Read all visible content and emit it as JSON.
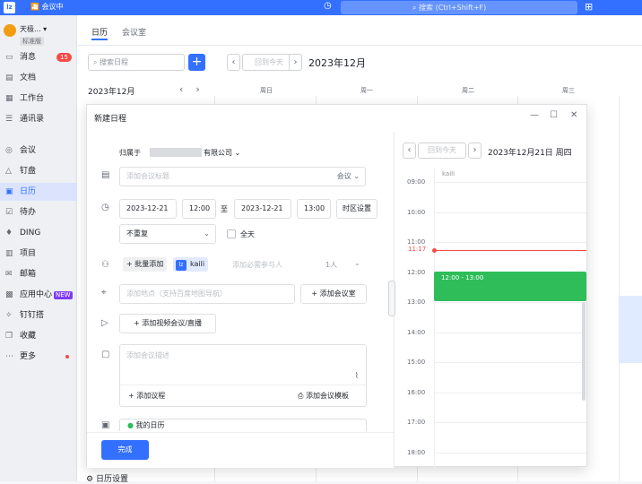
{
  "topbar": {
    "logo": "lz",
    "meeting_status": "会议中",
    "search_placeholder": "搜索 (Ctrl+Shift+F)"
  },
  "sidebar": {
    "user_name": "天极...",
    "user_tag": "标准版",
    "items": [
      {
        "icon": "message-icon",
        "glyph": "▭",
        "label": "消息",
        "badge": "15"
      },
      {
        "icon": "doc-icon",
        "glyph": "▤",
        "label": "文档"
      },
      {
        "icon": "workbench-icon",
        "glyph": "▦",
        "label": "工作台"
      },
      {
        "icon": "contacts-icon",
        "glyph": "☰",
        "label": "通讯录"
      },
      {
        "icon": "meeting-icon",
        "glyph": "◎",
        "label": "会议"
      },
      {
        "icon": "disk-icon",
        "glyph": "△",
        "label": "钉盘"
      },
      {
        "icon": "calendar-icon",
        "glyph": "▣",
        "label": "日历"
      },
      {
        "icon": "todo-icon",
        "glyph": "☑",
        "label": "待办"
      },
      {
        "icon": "ding-icon",
        "glyph": "♦",
        "label": "DING"
      },
      {
        "icon": "project-icon",
        "glyph": "▥",
        "label": "项目"
      },
      {
        "icon": "mail-icon",
        "glyph": "✉",
        "label": "邮箱"
      },
      {
        "icon": "app-center-icon",
        "glyph": "▩",
        "label": "应用中心",
        "tag": "NEW"
      },
      {
        "icon": "dingding-icon",
        "glyph": "✧",
        "label": "钉钉搭"
      },
      {
        "icon": "favorites-icon",
        "glyph": "❒",
        "label": "收藏"
      },
      {
        "icon": "more-icon",
        "glyph": "⋯",
        "label": "更多"
      }
    ]
  },
  "calendar": {
    "tabs": [
      "日历",
      "会议室"
    ],
    "search_placeholder": "搜索日程",
    "mini_month": "2023年12月",
    "today_label": "回到今天",
    "main_title": "2023年12月",
    "weekdays": [
      "周日",
      "周一",
      "周二",
      "周三"
    ],
    "settings_label": "日历设置"
  },
  "dialog": {
    "title": "新建日程",
    "belongs_label": "归属于",
    "company": "有限公司",
    "subject_placeholder": "添加会议标题",
    "type_select": "会议",
    "start_date": "2023-12-21",
    "start_time": "12:00",
    "to_label": "至",
    "end_date": "2023-12-21",
    "end_time": "13:00",
    "timezone_label": "时区设置",
    "repeat_select": "不重复",
    "allday_label": "全天",
    "add_attendee_btn": "+ 批量添加",
    "attendee_avatar": "lz",
    "attendee_name": "kaili",
    "attendee_placeholder": "添加必需参与人",
    "attendee_count": "1人",
    "location_placeholder": "添加地点（支持百度地图导航）",
    "add_room_btn": "添加会议室",
    "video_btn": "添加视频会议/直播",
    "desc_placeholder": "添加会议描述",
    "agenda_btn": "添加议程",
    "template_btn": "添加会议模板",
    "calendar_select": "我的日历",
    "done_btn": "完成"
  },
  "day_view": {
    "today_label": "回到今天",
    "title": "2023年12月21日 周四",
    "attendee": "kaili",
    "hours": [
      "09:00",
      "10:00",
      "11:00",
      "12:00",
      "13:00",
      "14:00",
      "15:00",
      "16:00",
      "17:00",
      "18:00"
    ],
    "now_label": "11:17",
    "event_label": "12:00 - 13:00"
  },
  "colors": {
    "accent": "#3370ff",
    "event": "#2ebd59",
    "now": "#f54a45"
  }
}
